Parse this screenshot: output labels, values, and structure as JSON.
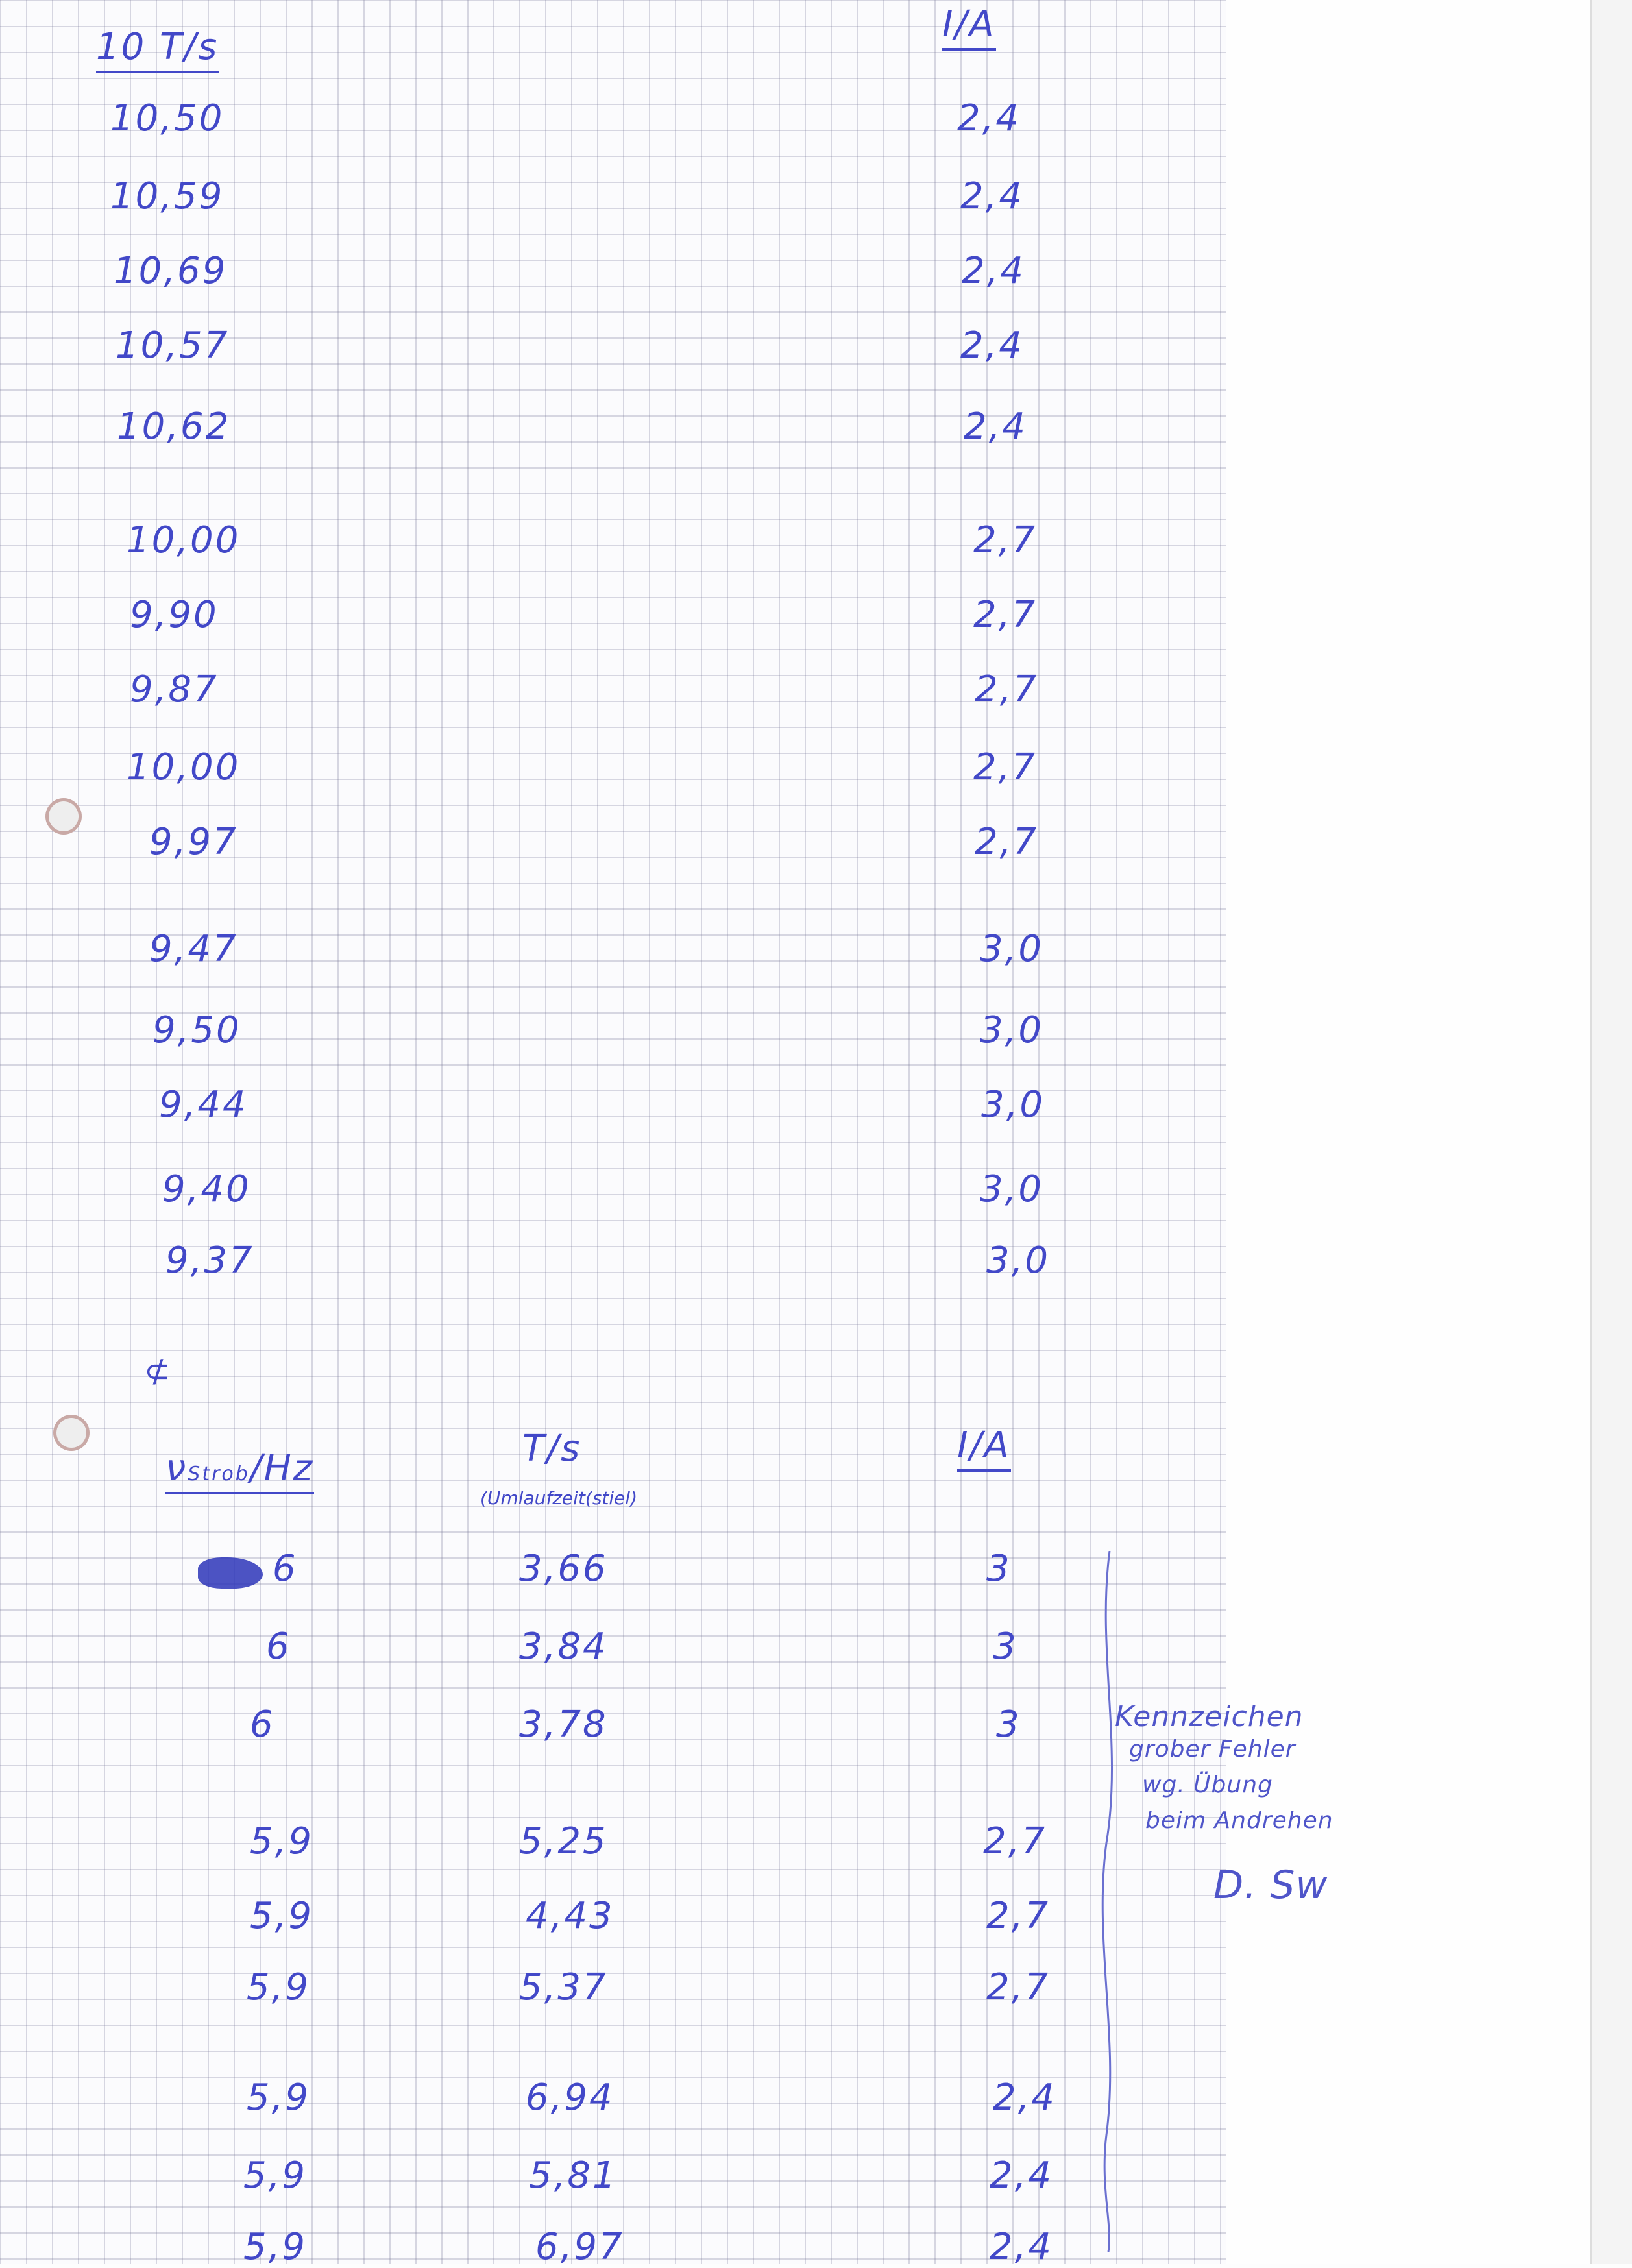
{
  "table1": {
    "header_t": "10 T/s",
    "header_i": "I/A",
    "t_values": [
      "10,50",
      "10,59",
      "10,69",
      "10,57",
      "10,62",
      "10,00",
      "9,90",
      "9,87",
      "10,00",
      "9,97",
      "9,47",
      "9,50",
      "9,44",
      "9,40",
      "9,37"
    ],
    "i_values": [
      "2,4",
      "2,4",
      "2,4",
      "2,4",
      "2,4",
      "2,7",
      "2,7",
      "2,7",
      "2,7",
      "2,7",
      "3,0",
      "3,0",
      "3,0",
      "3,0",
      "3,0"
    ]
  },
  "table2": {
    "header_v": "ν",
    "header_v_sub": "Strob",
    "header_v_unit": "/Hz",
    "header_t": "T",
    "header_t_unit": "/s",
    "header_t_note": "(Umlaufzeit(stiel)",
    "header_i": "I/A",
    "v_values": [
      "6",
      "6",
      "6",
      "5,9",
      "5,9",
      "5,9",
      "5,9",
      "5,9",
      "5,9"
    ],
    "t_values": [
      "3,66",
      "3,84",
      "3,78",
      "5,25",
      "4,43",
      "5,37",
      "6,94",
      "5,81",
      "6,97"
    ],
    "i_values": [
      "3",
      "3",
      "3",
      "2,7",
      "2,7",
      "2,7",
      "2,4",
      "2,4",
      "2,4"
    ]
  },
  "annotation": {
    "lines": [
      "Kennzeichen",
      "grober Fehler",
      "wg. Übung",
      "beim Andrehen"
    ],
    "signature": "D. Sw"
  }
}
